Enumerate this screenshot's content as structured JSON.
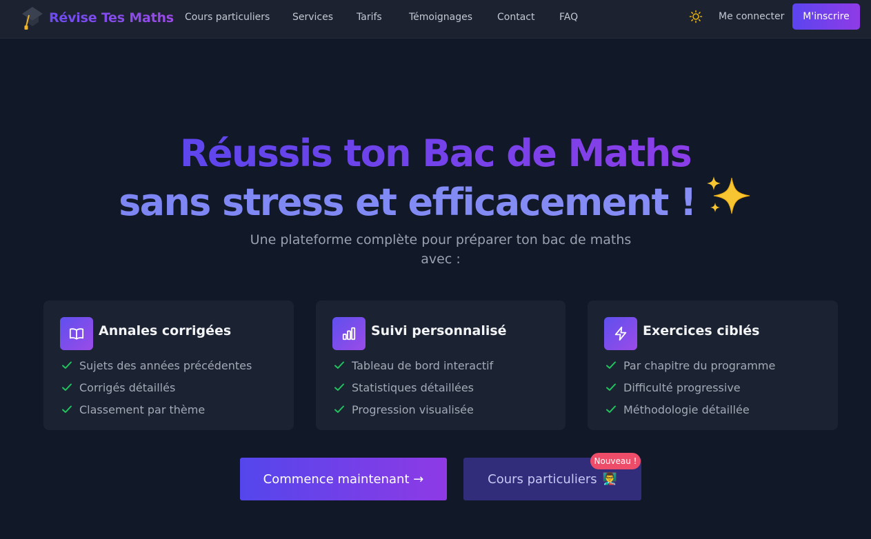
{
  "brand": {
    "name": "Révise Tes Maths"
  },
  "nav": {
    "links": [
      "Cours particuliers",
      "Services",
      "Tarifs",
      "Témoignages",
      "Contact",
      "FAQ"
    ],
    "theme_icon": "sun-icon",
    "login": "Me connecter",
    "signup": "M'inscrire"
  },
  "hero": {
    "title_line1": "Réussis ton Bac de Maths",
    "title_line2": "sans stress et efficacement !",
    "title_emoji": "✨",
    "subtitle": "Une plateforme complète pour préparer ton bac de maths avec :"
  },
  "features": [
    {
      "icon": "book-open-icon",
      "title": "Annales corrigées",
      "items": [
        "Sujets des années précédentes",
        "Corrigés détaillés",
        "Classement par thème"
      ]
    },
    {
      "icon": "bar-chart-icon",
      "title": "Suivi personnalisé",
      "items": [
        "Tableau de bord interactif",
        "Statistiques détaillées",
        "Progression visualisée"
      ]
    },
    {
      "icon": "lightning-icon",
      "title": "Exercices ciblés",
      "items": [
        "Par chapitre du programme",
        "Difficulté progressive",
        "Méthodologie détaillée"
      ]
    }
  ],
  "cta": {
    "primary": "Commence maintenant →",
    "secondary": "Cours particuliers",
    "secondary_emoji": "👨‍🏫",
    "badge": "Nouveau !"
  },
  "colors": {
    "background": "#111827",
    "navbar": "#1c2230",
    "card": "#1b2232",
    "accent_start": "#5b45ef",
    "accent_end": "#8f3be6",
    "check": "#22c55e",
    "badge": "#ee4d69"
  }
}
